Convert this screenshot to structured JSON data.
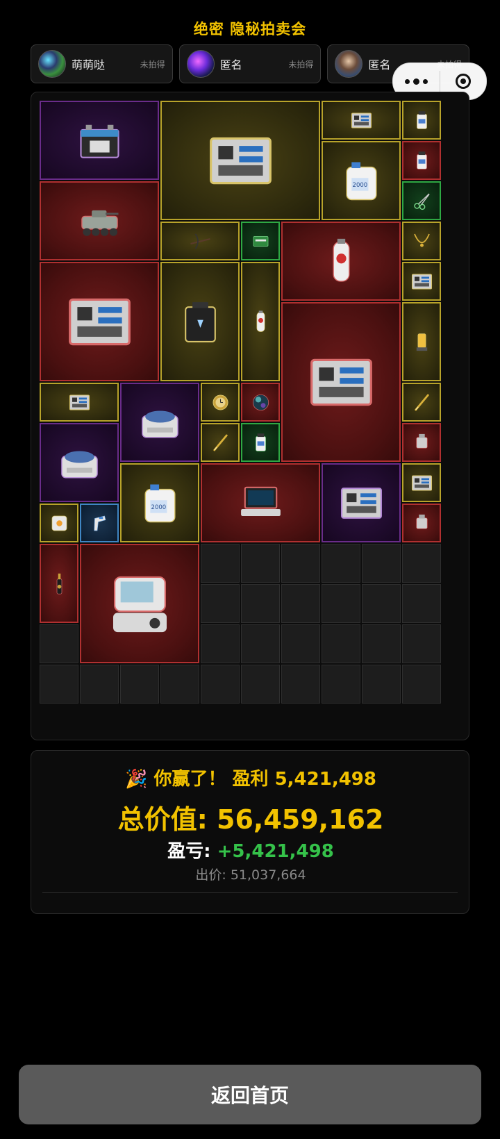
{
  "header": {
    "title": "绝密 隐秘拍卖会"
  },
  "bidders": [
    {
      "name": "萌萌哒",
      "status": "未拍得"
    },
    {
      "name": "匿名",
      "status": "未拍得"
    },
    {
      "name": "匿名",
      "status": "未拍得"
    }
  ],
  "capsule": {
    "more_icon": "more-dots-icon",
    "close_icon": "target-close-icon"
  },
  "items": [
    {
      "name": "car-battery",
      "rarity": "purple",
      "icon": "battery-icon"
    },
    {
      "name": "server-rack-blade",
      "rarity": "gold",
      "icon": "server-blade-icon"
    },
    {
      "name": "graphics-card",
      "rarity": "gold",
      "icon": "gpu-icon"
    },
    {
      "name": "ink-bottle",
      "rarity": "gold",
      "icon": "bottle-icon"
    },
    {
      "name": "caviar-tin",
      "rarity": "red",
      "icon": "tin-icon"
    },
    {
      "name": "scissors",
      "rarity": "green",
      "icon": "scissors-icon"
    },
    {
      "name": "armored-vehicle",
      "rarity": "red",
      "icon": "tank-icon"
    },
    {
      "name": "oil-jug",
      "rarity": "gold",
      "icon": "jug-icon"
    },
    {
      "name": "crossbow",
      "rarity": "gold",
      "icon": "crossbow-icon"
    },
    {
      "name": "cigar-pack",
      "rarity": "green",
      "icon": "pack-icon"
    },
    {
      "name": "gas-cylinder",
      "rarity": "red",
      "icon": "cylinder-icon"
    },
    {
      "name": "gold-necklace",
      "rarity": "gold",
      "icon": "necklace-icon"
    },
    {
      "name": "ssd-drive",
      "rarity": "gold",
      "icon": "ssd-icon"
    },
    {
      "name": "server-board",
      "rarity": "red",
      "icon": "board-icon"
    },
    {
      "name": "power-station",
      "rarity": "gold",
      "icon": "power-station-icon"
    },
    {
      "name": "oxygen-tank",
      "rarity": "gold",
      "icon": "oxygen-icon"
    },
    {
      "name": "server-tower",
      "rarity": "red",
      "icon": "server-tower-icon"
    },
    {
      "name": "hydraulic-pump",
      "rarity": "gold",
      "icon": "pump-icon"
    },
    {
      "name": "gpu-small",
      "rarity": "gold",
      "icon": "gpu-icon"
    },
    {
      "name": "centrifuge",
      "rarity": "purple",
      "icon": "centrifuge-icon"
    },
    {
      "name": "gold-watch",
      "rarity": "gold",
      "icon": "watch-icon"
    },
    {
      "name": "orb",
      "rarity": "red",
      "icon": "orb-icon"
    },
    {
      "name": "gold-pen",
      "rarity": "gold",
      "icon": "pen-icon"
    },
    {
      "name": "incubator",
      "rarity": "purple",
      "icon": "incubator-icon"
    },
    {
      "name": "gold-pen-2",
      "rarity": "gold",
      "icon": "pen-icon"
    },
    {
      "name": "medicine-bottle",
      "rarity": "green",
      "icon": "medicine-icon"
    },
    {
      "name": "spark-plug",
      "rarity": "red",
      "icon": "plug-icon"
    },
    {
      "name": "oil-jug-2",
      "rarity": "gold",
      "icon": "jug-icon"
    },
    {
      "name": "rugged-laptop",
      "rarity": "red",
      "icon": "laptop-icon"
    },
    {
      "name": "motherboard",
      "rarity": "purple",
      "icon": "motherboard-icon"
    },
    {
      "name": "hard-drive",
      "rarity": "gold",
      "icon": "hdd-icon"
    },
    {
      "name": "companion-cube",
      "rarity": "gold",
      "icon": "cube-icon"
    },
    {
      "name": "thermometer-gun",
      "rarity": "blue",
      "icon": "thermometer-icon"
    },
    {
      "name": "usb-stick",
      "rarity": "red",
      "icon": "usb-icon"
    },
    {
      "name": "champagne",
      "rarity": "red",
      "icon": "champagne-icon"
    },
    {
      "name": "ventilator",
      "rarity": "red",
      "icon": "ventilator-icon"
    }
  ],
  "result": {
    "win_emoji": "🎉",
    "win_text": "你赢了！ 盈利 5,421,498",
    "total_label": "总价值: ",
    "total_value": "56,459,162",
    "pl_label": "盈亏: ",
    "pl_value": "+5,421,498",
    "bid_text": "出价: 51,037,664"
  },
  "home_button": {
    "label": "返回首页"
  }
}
